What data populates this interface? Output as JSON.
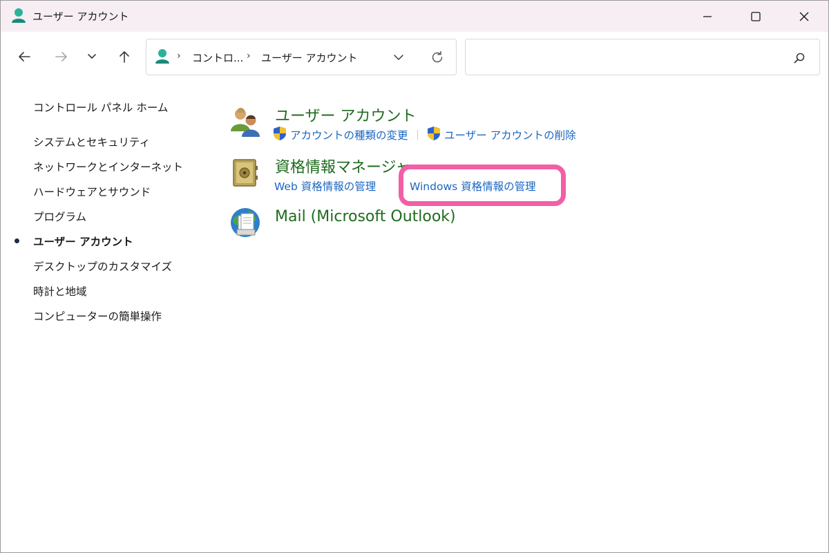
{
  "window": {
    "title": "ユーザー アカウント",
    "title_icon": "user-accounts-icon"
  },
  "titlebar_buttons": {
    "minimize": "minimize-icon",
    "maximize": "maximize-icon",
    "close": "close-icon"
  },
  "navigation": {
    "back": "back-arrow-icon",
    "forward": "forward-arrow-icon",
    "recent": "chevron-down-icon",
    "up": "up-arrow-icon"
  },
  "address_bar": {
    "icon": "user-accounts-icon",
    "separator": "›",
    "crumbs": [
      "コントロ...",
      "ユーザー アカウント"
    ],
    "dropdown": "chevron-down-icon",
    "refresh": "refresh-icon"
  },
  "search": {
    "placeholder": "",
    "icon": "search-icon"
  },
  "sidebar": {
    "items": [
      {
        "label": "コントロール パネル ホーム",
        "active": false
      },
      {
        "label": "システムとセキュリティ",
        "active": false
      },
      {
        "label": "ネットワークとインターネット",
        "active": false
      },
      {
        "label": "ハードウェアとサウンド",
        "active": false
      },
      {
        "label": "プログラム",
        "active": false
      },
      {
        "label": "ユーザー アカウント",
        "active": true
      },
      {
        "label": "デスクトップのカスタマイズ",
        "active": false
      },
      {
        "label": "時計と地域",
        "active": false
      },
      {
        "label": "コンピューターの簡単操作",
        "active": false
      }
    ]
  },
  "categories": [
    {
      "title": "ユーザー アカウント",
      "icon": "users-icon",
      "links": [
        {
          "label": "アカウントの種類の変更",
          "icon": "uac-shield-icon"
        },
        {
          "label": "ユーザー アカウントの削除",
          "icon": "uac-shield-icon"
        }
      ]
    },
    {
      "title": "資格情報マネージャー",
      "icon": "vault-icon",
      "links": [
        {
          "label": "Web 資格情報の管理"
        },
        {
          "label": "Windows 資格情報の管理",
          "highlighted": true
        }
      ]
    },
    {
      "title": "Mail (Microsoft Outlook)",
      "icon": "mail-globe-icon",
      "links": []
    }
  ],
  "colors": {
    "category_title": "#1e6b1e",
    "link": "#1a66c2",
    "highlight": "#f25fa5",
    "titlebar": "#f6eef2",
    "active_bullet": "#1f2a4d"
  }
}
